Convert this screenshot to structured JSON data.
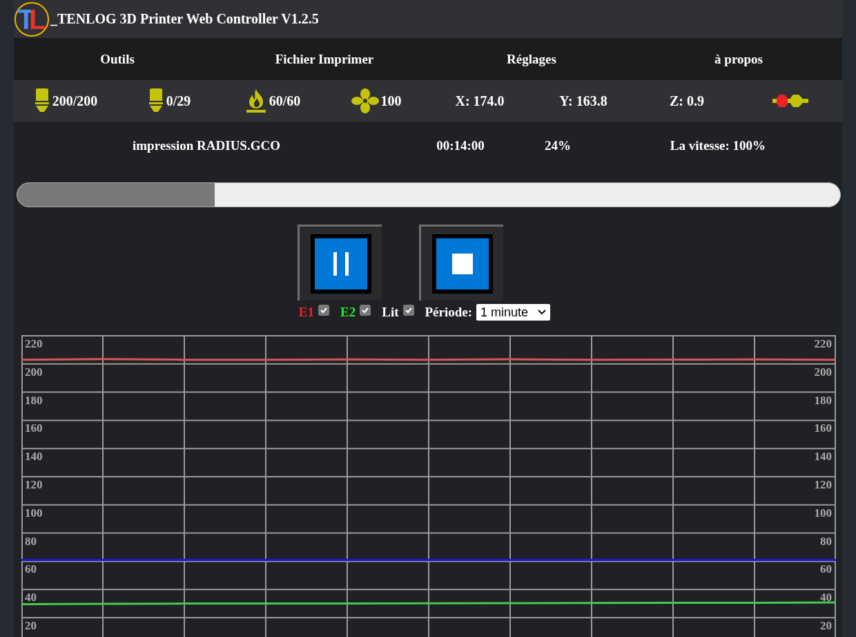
{
  "header": {
    "logo": {
      "first": "T",
      "second": "L"
    },
    "title": "_TENLOG 3D Printer Web Controller V1.2.5"
  },
  "nav": [
    {
      "label": "Outils"
    },
    {
      "label": "Fichier Imprimer"
    },
    {
      "label": "Réglages"
    },
    {
      "label": "à propos"
    }
  ],
  "status": [
    {
      "kind": "nozzle",
      "value": "200/200"
    },
    {
      "kind": "nozzle",
      "value": "0/29"
    },
    {
      "kind": "bed",
      "value": "60/60"
    },
    {
      "kind": "fan",
      "value": "100"
    },
    {
      "kind": "text",
      "value": "X: 174.0"
    },
    {
      "kind": "text",
      "value": "Y: 163.8"
    },
    {
      "kind": "text",
      "value": "Z: 0.9"
    },
    {
      "kind": "link"
    }
  ],
  "job": {
    "file": "impression RADIUS.GCO",
    "time": "00:14:00",
    "percent": "24%",
    "speed": "La vitesse: 100%"
  },
  "progress": {
    "level": 0.24
  },
  "buttons": [
    {
      "kind": "pause"
    },
    {
      "kind": "stop"
    }
  ],
  "legend": [
    {
      "color": "#e8262b",
      "checked": true
    },
    {
      "color": "#2ee82e",
      "checked": true
    },
    {
      "color": "#ffffff",
      "checked": true
    }
  ],
  "period": {
    "label": "Période:",
    "value": "1 minute"
  },
  "chart_data": {
    "type": "line",
    "grid": true,
    "ylim": [
      20,
      220
    ],
    "yticks": [
      20,
      40,
      60,
      80,
      100,
      120,
      140,
      160,
      180,
      200,
      220
    ],
    "y2lim": [
      20,
      220
    ],
    "y2ticks": [
      20,
      40,
      60,
      80,
      100,
      120,
      140,
      160,
      180,
      200,
      220
    ],
    "series": [
      {
        "name": "E1",
        "color": "#d9575a",
        "values": [
          203,
          203.5,
          203,
          203,
          203.2,
          203,
          203.3,
          203,
          203.1,
          203.2,
          203
        ]
      },
      {
        "name": "E2",
        "color": "#4cc94c",
        "values": [
          29.5,
          29.8,
          30,
          30,
          30.1,
          30.2,
          30.3,
          30.4,
          30.5,
          30.6,
          30.8
        ]
      },
      {
        "name": "Lit",
        "color": "#1a1ad6",
        "values": [
          61,
          61,
          61,
          61,
          61,
          61,
          61,
          61,
          61,
          61,
          61
        ]
      }
    ]
  }
}
